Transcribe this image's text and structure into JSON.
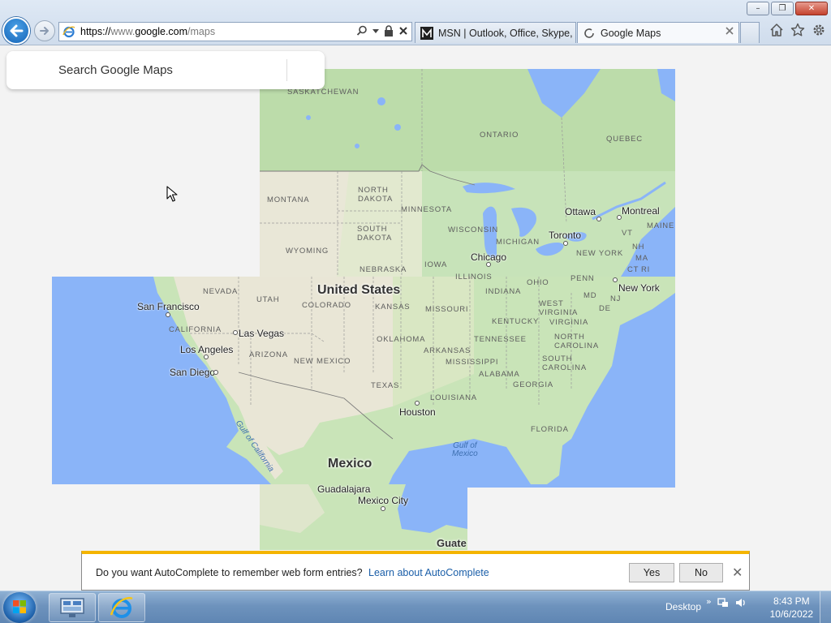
{
  "browser": {
    "address": {
      "scheme": "https://",
      "host_prefix": "www.",
      "host": "google.com",
      "path": "/maps"
    },
    "tabs": [
      {
        "label": "MSN | Outlook, Office, Skype, ...",
        "active": false
      },
      {
        "label": "Google Maps",
        "active": true
      }
    ],
    "window_buttons": {
      "minimize": "–",
      "restore": "❐",
      "close": "✕"
    }
  },
  "maps": {
    "search_placeholder": "Search Google Maps",
    "labels": {
      "saskatchewan": "SASKATCHEWAN",
      "ontario": "ONTARIO",
      "quebec": "QUEBEC",
      "montana": "MONTANA",
      "north_dakota_1": "NORTH",
      "north_dakota_2": "DAKOTA",
      "minnesota": "MINNESOTA",
      "ottawa": "Ottawa",
      "montreal": "Montreal",
      "maine": "MAINE",
      "south_dakota_1": "SOUTH",
      "south_dakota_2": "DAKOTA",
      "wisconsin": "WISCONSIN",
      "michigan": "MICHIGAN",
      "toronto": "Toronto",
      "vt": "VT",
      "nh": "NH",
      "wyoming": "WYOMING",
      "new_york_state": "NEW YORK",
      "ma": "MA",
      "nebraska": "NEBRASKA",
      "iowa": "IOWA",
      "chicago": "Chicago",
      "ct": "CT",
      "ri": "RI",
      "nevada": "NEVADA",
      "united_states": "United States",
      "illinois": "ILLINOIS",
      "ohio": "OHIO",
      "penn": "PENN",
      "utah": "UTAH",
      "indiana": "INDIANA",
      "md": "MD",
      "new_york_city": "New York",
      "nj": "NJ",
      "san_francisco": "San Francisco",
      "colorado": "COLORADO",
      "kansas": "KANSAS",
      "missouri": "MISSOURI",
      "west_virginia_1": "WEST",
      "west_virginia_2": "VIRGINIA",
      "de": "DE",
      "california": "CALIFORNIA",
      "kentucky": "KENTUCKY",
      "virginia": "VIRGINIA",
      "las_vegas": "Las Vegas",
      "oklahoma": "OKLAHOMA",
      "tennessee": "TENNESSEE",
      "north_carolina_1": "NORTH",
      "north_carolina_2": "CAROLINA",
      "los_angeles": "Los Angeles",
      "arizona": "ARIZONA",
      "new_mexico": "NEW MEXICO",
      "arkansas": "ARKANSAS",
      "south_carolina_1": "SOUTH",
      "south_carolina_2": "CAROLINA",
      "mississippi": "MISSISSIPPI",
      "san_diego": "San Diego",
      "alabama": "ALABAMA",
      "georgia": "GEORGIA",
      "texas": "TEXAS",
      "louisiana": "LOUISIANA",
      "gulf_california": "Gulf of California",
      "houston": "Houston",
      "florida": "FLORIDA",
      "gulf_mexico_1": "Gulf of",
      "gulf_mexico_2": "Mexico",
      "mexico": "Mexico",
      "guadalajara": "Guadalajara",
      "mexico_city": "Mexico City",
      "guate": "Guate"
    }
  },
  "notification": {
    "message": "Do you want AutoComplete to remember web form entries?",
    "link": "Learn about AutoComplete",
    "yes": "Yes",
    "no": "No",
    "close": "✕"
  },
  "taskbar": {
    "desktop_label": "Desktop",
    "time": "8:43 PM",
    "date": "10/6/2022"
  },
  "colors": {
    "accent_ie_blue": "#1565b8",
    "notification_bar": "#f4b400",
    "map_water": "#8ab4f8",
    "map_land": "#bfdfb0",
    "taskbar": "#6e93bd"
  }
}
